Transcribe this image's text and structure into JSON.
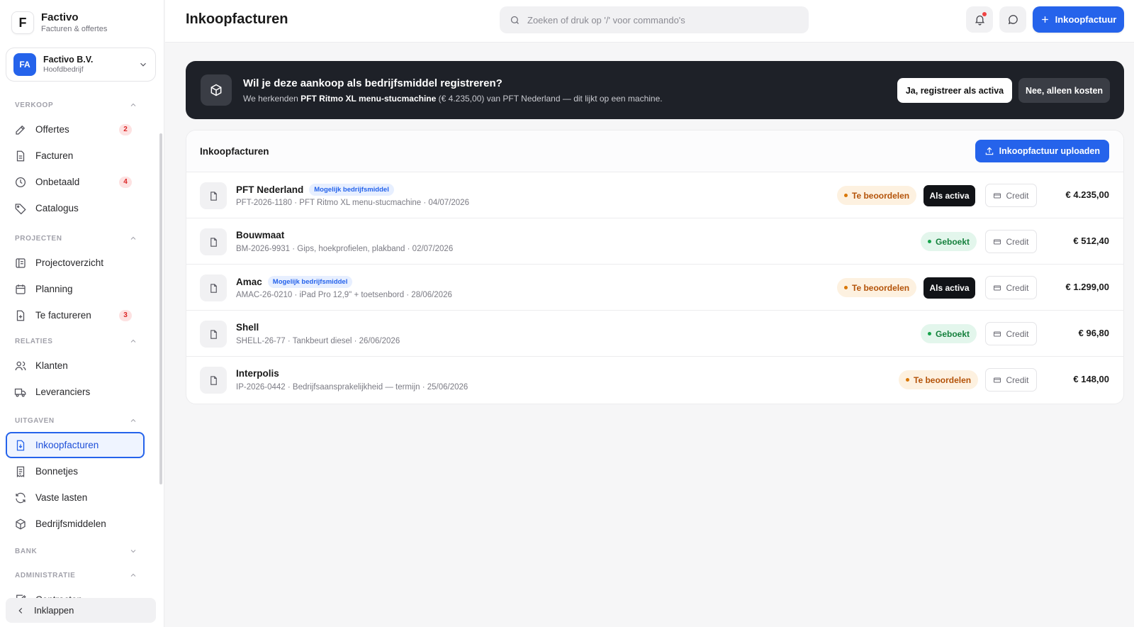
{
  "brand": {
    "name": "Factivo",
    "subtitle": "Facturen & offertes",
    "logo_letter": "F"
  },
  "company": {
    "initials": "FA",
    "name": "Factivo B.V.",
    "subtitle": "Hoofdbedrijf"
  },
  "sidebar": {
    "sections": {
      "verkoop": "VERKOOP",
      "projecten": "PROJECTEN",
      "relaties": "RELATIES",
      "uitgaven": "UITGAVEN",
      "bank": "BANK",
      "administratie": "ADMINISTRATIE"
    },
    "items": {
      "offertes": {
        "label": "Offertes",
        "badge": "2"
      },
      "facturen": {
        "label": "Facturen"
      },
      "onbetaald": {
        "label": "Onbetaald",
        "badge": "4"
      },
      "catalogus": {
        "label": "Catalogus"
      },
      "projectoverzicht": {
        "label": "Projectoverzicht"
      },
      "planning": {
        "label": "Planning"
      },
      "te_factureren": {
        "label": "Te factureren",
        "badge": "3"
      },
      "klanten": {
        "label": "Klanten"
      },
      "leveranciers": {
        "label": "Leveranciers"
      },
      "inkoopfacturen": {
        "label": "Inkoopfacturen"
      },
      "bonnetjes": {
        "label": "Bonnetjes"
      },
      "vaste_lasten": {
        "label": "Vaste lasten"
      },
      "bedrijfsmiddelen": {
        "label": "Bedrijfsmiddelen"
      },
      "contracten": {
        "label": "Contracten"
      }
    },
    "collapse_label": "Inklappen"
  },
  "header": {
    "title": "Inkoopfacturen",
    "search_placeholder": "Zoeken of druk op '/' voor commando's",
    "new_button_label": "Inkoopfactuur"
  },
  "banner": {
    "title": "Wil je deze aankoop als bedrijfsmiddel registreren?",
    "text_prefix": "We herkenden ",
    "text_item": "PFT Ritmo XL menu-stucmachine",
    "text_suffix": " (€ 4.235,00) van PFT Nederland — dit lijkt op een machine.",
    "yes_label": "Ja, registreer als activa",
    "no_label": "Nee, alleen kosten"
  },
  "invoices": {
    "title": "Inkoopfacturen",
    "upload_label": "Inkoopfactuur uploaden",
    "activa_label": "Als activa",
    "credit_label": "Credit",
    "rows": [
      {
        "supplier": "PFT Nederland",
        "tag": "Mogelijk bedrijfsmiddel",
        "details": "PFT-2026-1180 · PFT Ritmo XL menu-stucmachine · 04/07/2026",
        "status": "Te beoordelen",
        "amount": "€ 4.235,00"
      },
      {
        "supplier": "Bouwmaat",
        "tag": "",
        "details": "BM-2026-9931 · Gips, hoekprofielen, plakband · 02/07/2026",
        "status": "Geboekt",
        "amount": "€ 512,40"
      },
      {
        "supplier": "Amac",
        "tag": "Mogelijk bedrijfsmiddel",
        "details": "AMAC-26-0210 · iPad Pro 12,9\" + toetsenbord · 28/06/2026",
        "status": "Te beoordelen",
        "amount": "€ 1.299,00"
      },
      {
        "supplier": "Shell",
        "tag": "",
        "details": "SHELL-26-77 · Tankbeurt diesel · 26/06/2026",
        "status": "Geboekt",
        "amount": "€ 96,80"
      },
      {
        "supplier": "Interpolis",
        "tag": "",
        "details": "IP-2026-0442 · Bedrijfsaansprakelijkheid — termijn · 25/06/2026",
        "status": "Te beoordelen",
        "amount": "€ 148,00"
      }
    ]
  },
  "colors": {
    "accent": "#2563eb",
    "banner_bg": "#1e2128",
    "review": "#d97706",
    "booked": "#16a34a"
  }
}
